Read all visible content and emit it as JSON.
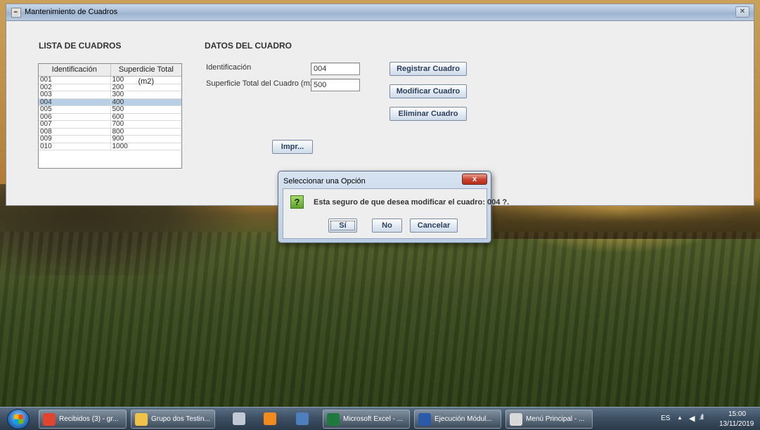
{
  "window": {
    "title": "Mantenimiento de Cuadros",
    "close_glyph": "✕"
  },
  "lista": {
    "title": "LISTA DE CUADROS",
    "columns": [
      "Identificación",
      "Superdicie Total (m2)"
    ],
    "rows": [
      [
        "001",
        "100"
      ],
      [
        "002",
        "200"
      ],
      [
        "003",
        "300"
      ],
      [
        "004",
        "400"
      ],
      [
        "005",
        "500"
      ],
      [
        "006",
        "600"
      ],
      [
        "007",
        "700"
      ],
      [
        "008",
        "800"
      ],
      [
        "009",
        "900"
      ],
      [
        "010",
        "1000"
      ]
    ],
    "selected_row": "004"
  },
  "datos": {
    "title": "DATOS DEL CUADRO",
    "id_label": "Identificación",
    "id_value": "004",
    "sup_label": "Superficie Total del Cuadro (m2)",
    "sup_value": "500",
    "btn_registrar": "Registrar Cuadro",
    "btn_modificar": "Modificar Cuadro",
    "btn_eliminar": "Eliminar Cuadro",
    "btn_imprimir": "Impr..."
  },
  "dialog": {
    "title": "Seleccionar una Opción",
    "close_glyph": "x",
    "icon_glyph": "?",
    "message": "Esta seguro de que desea modificar el cuadro: 004 ?.",
    "btn_si": "Sí",
    "btn_no": "No",
    "btn_cancelar": "Cancelar"
  },
  "taskbar": {
    "items": [
      {
        "label": "Recibidos (3) - gr...",
        "icon": "chrome-icon",
        "color": "#e0452f"
      },
      {
        "label": "Grupo dos Testin...",
        "icon": "folder-icon",
        "color": "#f1c24a"
      },
      {
        "label": "Microsoft Excel - ...",
        "icon": "excel-icon",
        "color": "#1e7a3c"
      },
      {
        "label": "Ejecución Módul...",
        "icon": "word-icon",
        "color": "#2b5aa8"
      },
      {
        "label": "Menú Principal - ...",
        "icon": "java-icon",
        "color": "#d9d9d9"
      }
    ],
    "pinned": [
      {
        "icon": "snipping-tool-icon",
        "color": "#c0c8d4"
      },
      {
        "icon": "orange-app-icon",
        "color": "#f28a1d"
      },
      {
        "icon": "network-tool-icon",
        "color": "#4d7fbf"
      }
    ],
    "language": "ES",
    "time": "15:00",
    "date": "13/11/2019"
  }
}
